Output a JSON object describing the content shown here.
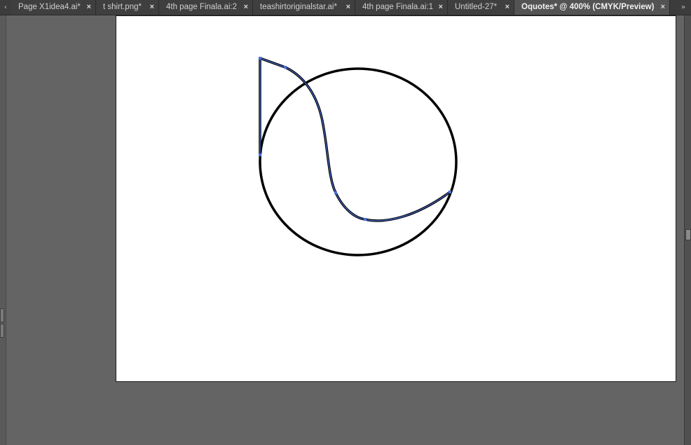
{
  "tabs": [
    {
      "label": "Page X1idea4.ai*",
      "close": "×",
      "active": false
    },
    {
      "label": "t shirt.png*",
      "close": "×",
      "active": false
    },
    {
      "label": "4th page Finala.ai:2",
      "close": "×",
      "active": false
    },
    {
      "label": "teashirtoriginalstar.ai*",
      "close": "×",
      "active": false
    },
    {
      "label": "4th page Finala.ai:1",
      "close": "×",
      "active": false
    },
    {
      "label": "Untitled-27*",
      "close": "×",
      "active": false
    },
    {
      "label": "Oquotes* @ 400% (CMYK/Preview)",
      "close": "×",
      "active": true
    }
  ],
  "tabbar": {
    "scroll_left_icon": "chevron-left-icon",
    "overflow_icon": "double-chevron-right-icon"
  },
  "canvas": {
    "background": "#ffffff",
    "stroke_color": "#000000",
    "selection_color": "#4a6fd8"
  }
}
